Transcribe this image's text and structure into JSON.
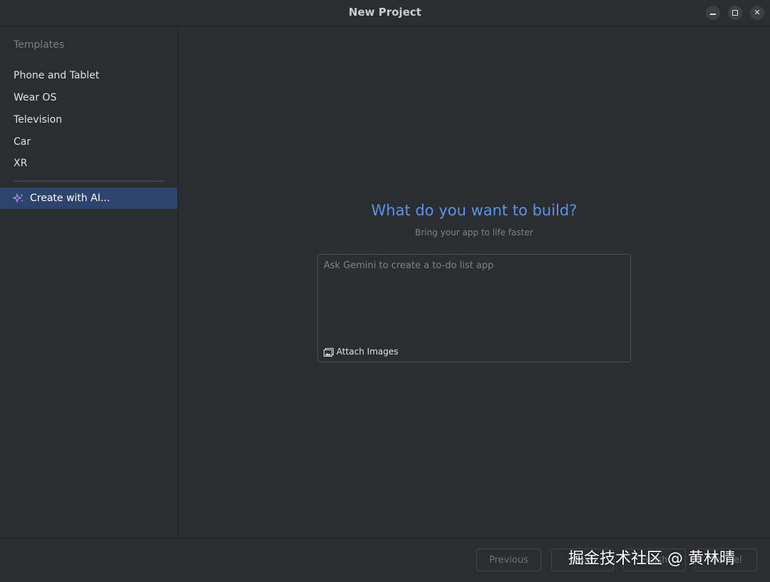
{
  "window": {
    "title": "New Project"
  },
  "sidebar": {
    "heading": "Templates",
    "items": [
      {
        "label": "Phone and Tablet"
      },
      {
        "label": "Wear OS"
      },
      {
        "label": "Television"
      },
      {
        "label": "Car"
      },
      {
        "label": "XR"
      }
    ],
    "ai_item": {
      "label": "Create with AI...",
      "icon": "sparkle-icon"
    }
  },
  "main": {
    "headline": "What do you want to build?",
    "subline": "Bring your app to life faster",
    "prompt": {
      "placeholder": "Ask Gemini to create a to-do list app",
      "value": ""
    },
    "attach": {
      "label": "Attach Images",
      "icon": "image-icon"
    }
  },
  "footer": {
    "buttons": {
      "previous": "Previous",
      "next": "Next",
      "finish": "Finish",
      "cancel": "Cancel"
    },
    "watermark": "掘金技术社区 @ 黄林晴"
  },
  "colors": {
    "accent": "#5894ea",
    "selection": "#2e436e",
    "background": "#2b2d30"
  }
}
